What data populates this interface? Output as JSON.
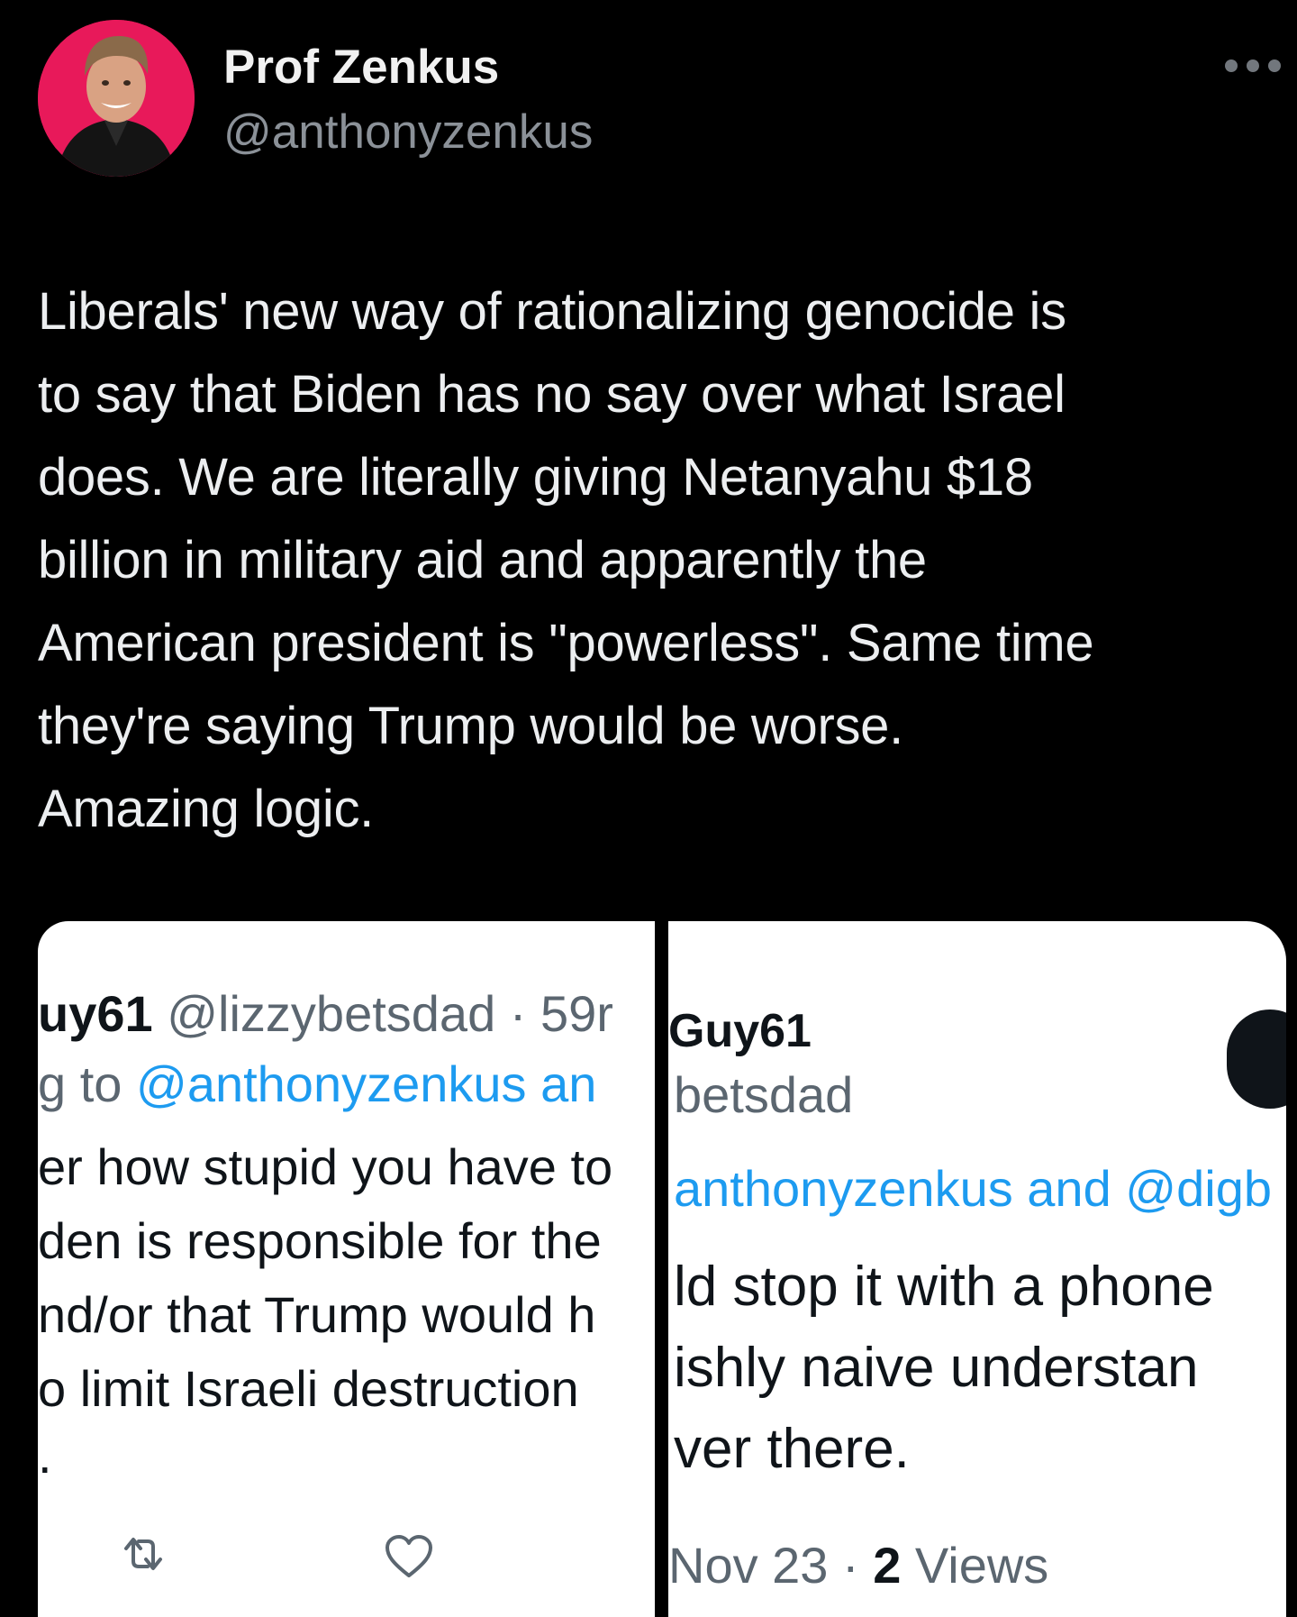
{
  "author": {
    "display_name": "Prof Zenkus",
    "handle": "@anthonyzenkus",
    "avatar": "profile-photo"
  },
  "more_icon": "more-horizontal-icon",
  "tweet": {
    "lines": [
      "Liberals' new way of rationalizing genocide is",
      "to say that Biden has no say over what Israel",
      "does. We are literally giving Netanyahu $18",
      "billion in military aid and apparently the",
      "American president is \"powerless\". Same time",
      "they're saying Trump would be worse.",
      "Amazing logic."
    ]
  },
  "screenshot_left": {
    "name_fragment": "uy61",
    "handle_time": "@lizzybetsdad · 59r",
    "reply_prefix": "g to ",
    "reply_mention": "@anthonyzenkus an",
    "body_lines": [
      "er how stupid you have to",
      "den is responsible for the",
      "nd/or that Trump would h",
      "o limit Israeli destruction",
      "."
    ],
    "icons": [
      "retweet-icon",
      "like-icon"
    ]
  },
  "screenshot_right": {
    "name_fragment": "Guy61",
    "handle_fragment": "betsdad",
    "reply_mention": "anthonyzenkus and @digb",
    "body_lines": [
      "ld stop it with a phone",
      "ishly naive understan",
      "ver there."
    ],
    "date": "Nov 23 · ",
    "views_count": "2",
    "views_label": " Views"
  }
}
